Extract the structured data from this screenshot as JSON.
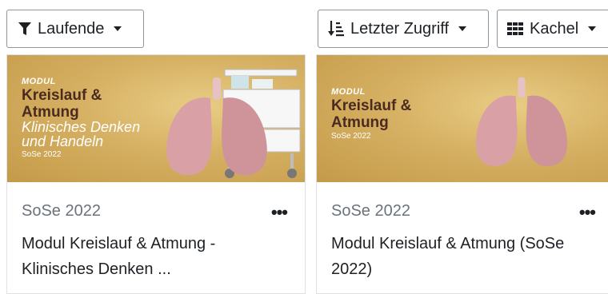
{
  "toolbar": {
    "filter_label": "Laufende",
    "sort_label": "Letzter Zugriff",
    "view_label": "Kachel"
  },
  "courses": [
    {
      "banner": {
        "modul": "MODUL",
        "title_line1": "Kreislauf &",
        "title_line2": "Atmung",
        "subtitle_line1": "Klinisches Denken",
        "subtitle_line2": "und Handeln",
        "term": "SoSe 2022"
      },
      "category": "SoSe 2022",
      "menu": "•••",
      "title": "Modul Kreislauf & Atmung - Klinisches Denken ..."
    },
    {
      "banner": {
        "modul": "MODUL",
        "title_line1": "Kreislauf &",
        "title_line2": "Atmung",
        "term": "SoSe 2022"
      },
      "category": "SoSe 2022",
      "menu": "•••",
      "title": "Modul Kreislauf & Atmung (SoSe 2022)"
    }
  ],
  "colors": {
    "banner_gold": "#d6b063",
    "banner_title": "#4b2a1f",
    "meta_text": "#6a737b",
    "lung": "#d9a0a6"
  },
  "icons": {
    "filter": "filter-icon",
    "sort": "sort-amount-icon",
    "view": "grid-icon",
    "menu": "more-horizontal-icon"
  }
}
